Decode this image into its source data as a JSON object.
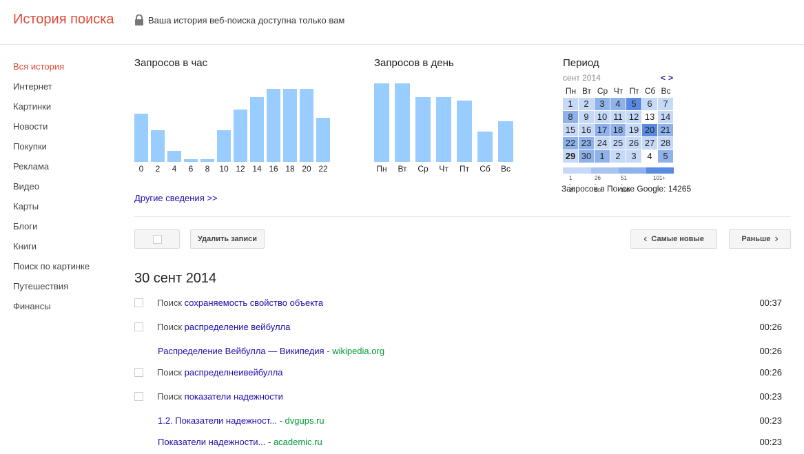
{
  "header": {
    "title": "История поиска",
    "privacy_text": "Ваша история веб-поиска доступна только вам"
  },
  "sidebar": {
    "items": [
      {
        "label": "Вся история",
        "active": true
      },
      {
        "label": "Интернет"
      },
      {
        "label": "Картинки"
      },
      {
        "label": "Новости"
      },
      {
        "label": "Покупки"
      },
      {
        "label": "Реклама"
      },
      {
        "label": "Видео"
      },
      {
        "label": "Карты"
      },
      {
        "label": "Блоги"
      },
      {
        "label": "Книги"
      },
      {
        "label": "Поиск по картинке"
      },
      {
        "label": "Путешествия"
      },
      {
        "label": "Финансы"
      }
    ]
  },
  "hourly": {
    "title": "Запросов в час",
    "ticks": [
      "0",
      "2",
      "4",
      "6",
      "8",
      "10",
      "12",
      "14",
      "16",
      "18",
      "20",
      "22"
    ],
    "values": [
      70,
      46,
      16,
      4,
      4,
      46,
      76,
      94,
      106,
      106,
      106,
      64
    ]
  },
  "daily": {
    "title": "Запросов в день",
    "ticks": [
      "Пн",
      "Вт",
      "Ср",
      "Чт",
      "Пт",
      "Сб",
      "Вс"
    ],
    "values": [
      114,
      114,
      94,
      94,
      89,
      44,
      59
    ]
  },
  "period": {
    "title": "Период",
    "month": "сент 2014",
    "nav_prev": "<",
    "nav_next": ">",
    "weekdays": [
      "Пн",
      "Вт",
      "Ср",
      "Чт",
      "Пт",
      "Сб",
      "Вс"
    ],
    "days": [
      [
        "1",
        "2",
        "3",
        "4",
        "5",
        "6",
        "7"
      ],
      [
        "8",
        "9",
        "10",
        "11",
        "12",
        "13",
        "14"
      ],
      [
        "15",
        "16",
        "17",
        "18",
        "19",
        "20",
        "21"
      ],
      [
        "22",
        "23",
        "24",
        "25",
        "26",
        "27",
        "28"
      ],
      [
        "29",
        "30",
        "1",
        "2",
        "3",
        "4",
        "5"
      ]
    ],
    "levels": [
      [
        1,
        1,
        2,
        2,
        3,
        1,
        1
      ],
      [
        2,
        1,
        1,
        1,
        1,
        0,
        1
      ],
      [
        1,
        1,
        2,
        2,
        1,
        3,
        2
      ],
      [
        2,
        2,
        1,
        1,
        1,
        1,
        1
      ],
      [
        1,
        2,
        2,
        1,
        1,
        0,
        2
      ]
    ],
    "legend": [
      "1 - 25",
      "26 - 50",
      "51 - 100",
      "101+"
    ],
    "total_label": "Запросов в Поиске Google: 14265",
    "colors": {
      "level0": "#ffffff",
      "level1": "#c6d9f7",
      "level2": "#8fb2eb",
      "level3": "#5a8be0"
    }
  },
  "more_link": "Другие сведения >>",
  "toolbar": {
    "delete_label": "Удалить записи",
    "newest_label": "Самые новые",
    "older_label": "Раньше"
  },
  "history": {
    "date": "30 сент 2014",
    "entries": [
      {
        "prefix": "Поиск",
        "query": "сохраняемость свойство объекта",
        "time": "00:37"
      },
      {
        "prefix": "Поиск",
        "query": "распределение вейбулла",
        "time": "00:26"
      },
      {
        "result_title": "Распределение Вейбулла — Википедия",
        "sep": "-",
        "domain": "wikipedia.org",
        "time": "00:26"
      },
      {
        "prefix": "Поиск",
        "query": "распределнеивейбулла",
        "time": "00:26"
      },
      {
        "prefix": "Поиск",
        "query": "показатели надежности",
        "time": "00:23"
      },
      {
        "result_title": "1.2. Показатели надежност...",
        "sep": "-",
        "domain": "dvgups.ru",
        "time": "00:23"
      },
      {
        "result_title": "Показатели надежности...",
        "sep": "-",
        "domain": "academic.ru",
        "time": "00:23"
      }
    ]
  }
}
